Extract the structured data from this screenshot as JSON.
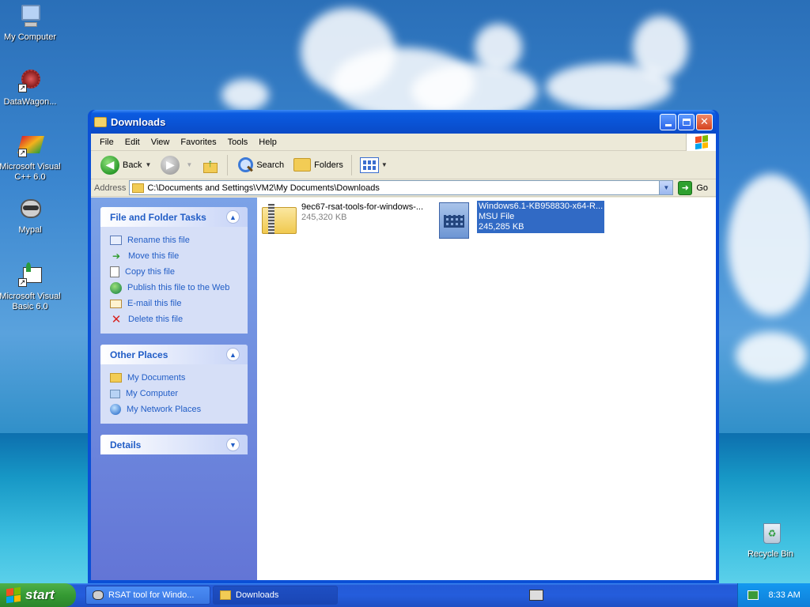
{
  "desktop": {
    "icons": [
      {
        "label": "My Computer"
      },
      {
        "label": "DataWagon..."
      },
      {
        "label": "Microsoft Visual C++ 6.0"
      },
      {
        "label": "Mypal"
      },
      {
        "label": "Microsoft Visual Basic 6.0"
      },
      {
        "label": "Recycle Bin"
      }
    ]
  },
  "window": {
    "title": "Downloads",
    "menu": [
      "File",
      "Edit",
      "View",
      "Favorites",
      "Tools",
      "Help"
    ],
    "toolbar": {
      "back": "Back",
      "search": "Search",
      "folders": "Folders"
    },
    "address": {
      "label": "Address",
      "value": "C:\\Documents and Settings\\VM2\\My Documents\\Downloads",
      "go": "Go"
    },
    "file_tasks": {
      "title": "File and Folder Tasks",
      "items": [
        "Rename this file",
        "Move this file",
        "Copy this file",
        "Publish this file to the Web",
        "E-mail this file",
        "Delete this file"
      ]
    },
    "other_places": {
      "title": "Other Places",
      "items": [
        "My Documents",
        "My Computer",
        "My Network Places"
      ]
    },
    "details": {
      "title": "Details"
    },
    "files": [
      {
        "name": "9ec67-rsat-tools-for-windows-...",
        "type": "",
        "size": "245,320 KB"
      },
      {
        "name": "Windows6.1-KB958830-x64-R...",
        "type": "MSU File",
        "size": "245,285 KB"
      }
    ]
  },
  "taskbar": {
    "start": "start",
    "tasks": [
      "RSAT tool for Windo...",
      "Downloads"
    ],
    "clock": "8:33 AM"
  },
  "colors": {
    "link": "#215dc6",
    "selection": "#316ac5",
    "titlebar": "#0a52d4",
    "start_green": "#359a33"
  }
}
